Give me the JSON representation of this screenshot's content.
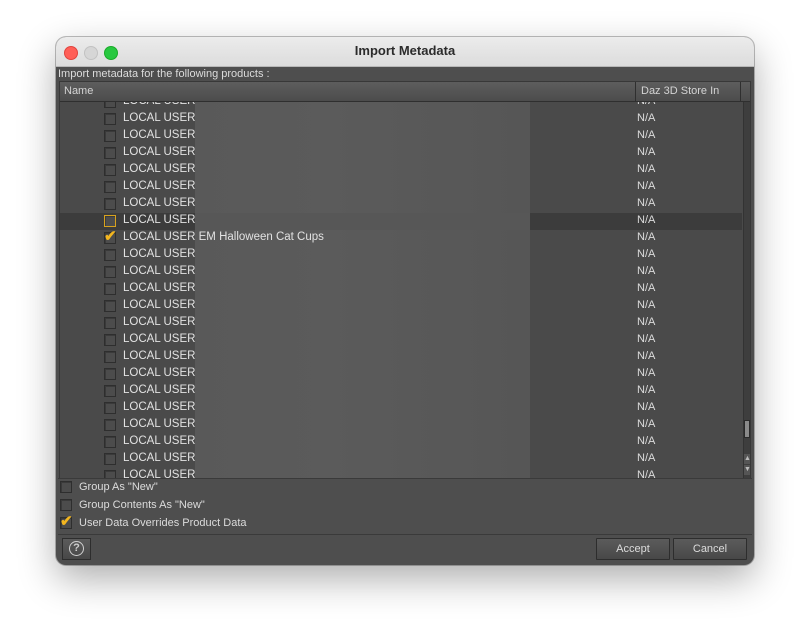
{
  "window": {
    "title": "Import Metadata"
  },
  "prompt": "Import metadata for the following products :",
  "columns": {
    "name": "Name",
    "store": "Daz 3D Store In"
  },
  "rows": [
    {
      "label": "LOCAL USER",
      "value": "N/A",
      "checked": false,
      "focused": false,
      "selected": false
    },
    {
      "label": "LOCAL USER",
      "value": "N/A",
      "checked": false,
      "focused": false,
      "selected": false
    },
    {
      "label": "LOCAL USER",
      "value": "N/A",
      "checked": false,
      "focused": false,
      "selected": false
    },
    {
      "label": "LOCAL USER",
      "value": "N/A",
      "checked": false,
      "focused": false,
      "selected": false
    },
    {
      "label": "LOCAL USER",
      "value": "N/A",
      "checked": false,
      "focused": false,
      "selected": false
    },
    {
      "label": "LOCAL USER",
      "value": "N/A",
      "checked": false,
      "focused": false,
      "selected": false
    },
    {
      "label": "LOCAL USER",
      "value": "N/A",
      "checked": false,
      "focused": false,
      "selected": false
    },
    {
      "label": "LOCAL USER",
      "value": "N/A",
      "checked": false,
      "focused": true,
      "selected": true
    },
    {
      "label": "LOCAL USER EM Halloween Cat Cups",
      "value": "N/A",
      "checked": true,
      "focused": false,
      "selected": false
    },
    {
      "label": "LOCAL USER",
      "value": "N/A",
      "checked": false,
      "focused": false,
      "selected": false
    },
    {
      "label": "LOCAL USER",
      "value": "N/A",
      "checked": false,
      "focused": false,
      "selected": false
    },
    {
      "label": "LOCAL USER",
      "value": "N/A",
      "checked": false,
      "focused": false,
      "selected": false
    },
    {
      "label": "LOCAL USER",
      "value": "N/A",
      "checked": false,
      "focused": false,
      "selected": false
    },
    {
      "label": "LOCAL USER",
      "value": "N/A",
      "checked": false,
      "focused": false,
      "selected": false
    },
    {
      "label": "LOCAL USER",
      "value": "N/A",
      "checked": false,
      "focused": false,
      "selected": false
    },
    {
      "label": "LOCAL USER",
      "value": "N/A",
      "checked": false,
      "focused": false,
      "selected": false
    },
    {
      "label": "LOCAL USER",
      "value": "N/A",
      "checked": false,
      "focused": false,
      "selected": false
    },
    {
      "label": "LOCAL USER",
      "value": "N/A",
      "checked": false,
      "focused": false,
      "selected": false
    },
    {
      "label": "LOCAL USER",
      "value": "N/A",
      "checked": false,
      "focused": false,
      "selected": false
    },
    {
      "label": "LOCAL USER",
      "value": "N/A",
      "checked": false,
      "focused": false,
      "selected": false
    },
    {
      "label": "LOCAL USER",
      "value": "N/A",
      "checked": false,
      "focused": false,
      "selected": false
    },
    {
      "label": "LOCAL USER",
      "value": "N/A",
      "checked": false,
      "focused": false,
      "selected": false
    },
    {
      "label": "LOCAL USER",
      "value": "N/A",
      "checked": false,
      "focused": false,
      "selected": false
    },
    {
      "label": "LOCAL USER",
      "value": "N/A",
      "checked": false,
      "focused": false,
      "selected": false
    }
  ],
  "options": [
    {
      "label": "Group As \"New\"",
      "checked": false
    },
    {
      "label": "Group Contents As \"New\"",
      "checked": false
    },
    {
      "label": "User Data Overrides Product Data",
      "checked": true
    }
  ],
  "buttons": {
    "help_icon": "help-icon",
    "accept": "Accept",
    "cancel": "Cancel"
  },
  "colors": {
    "check_accent": "#f3b61f",
    "panel_bg": "#4e4e4e"
  }
}
